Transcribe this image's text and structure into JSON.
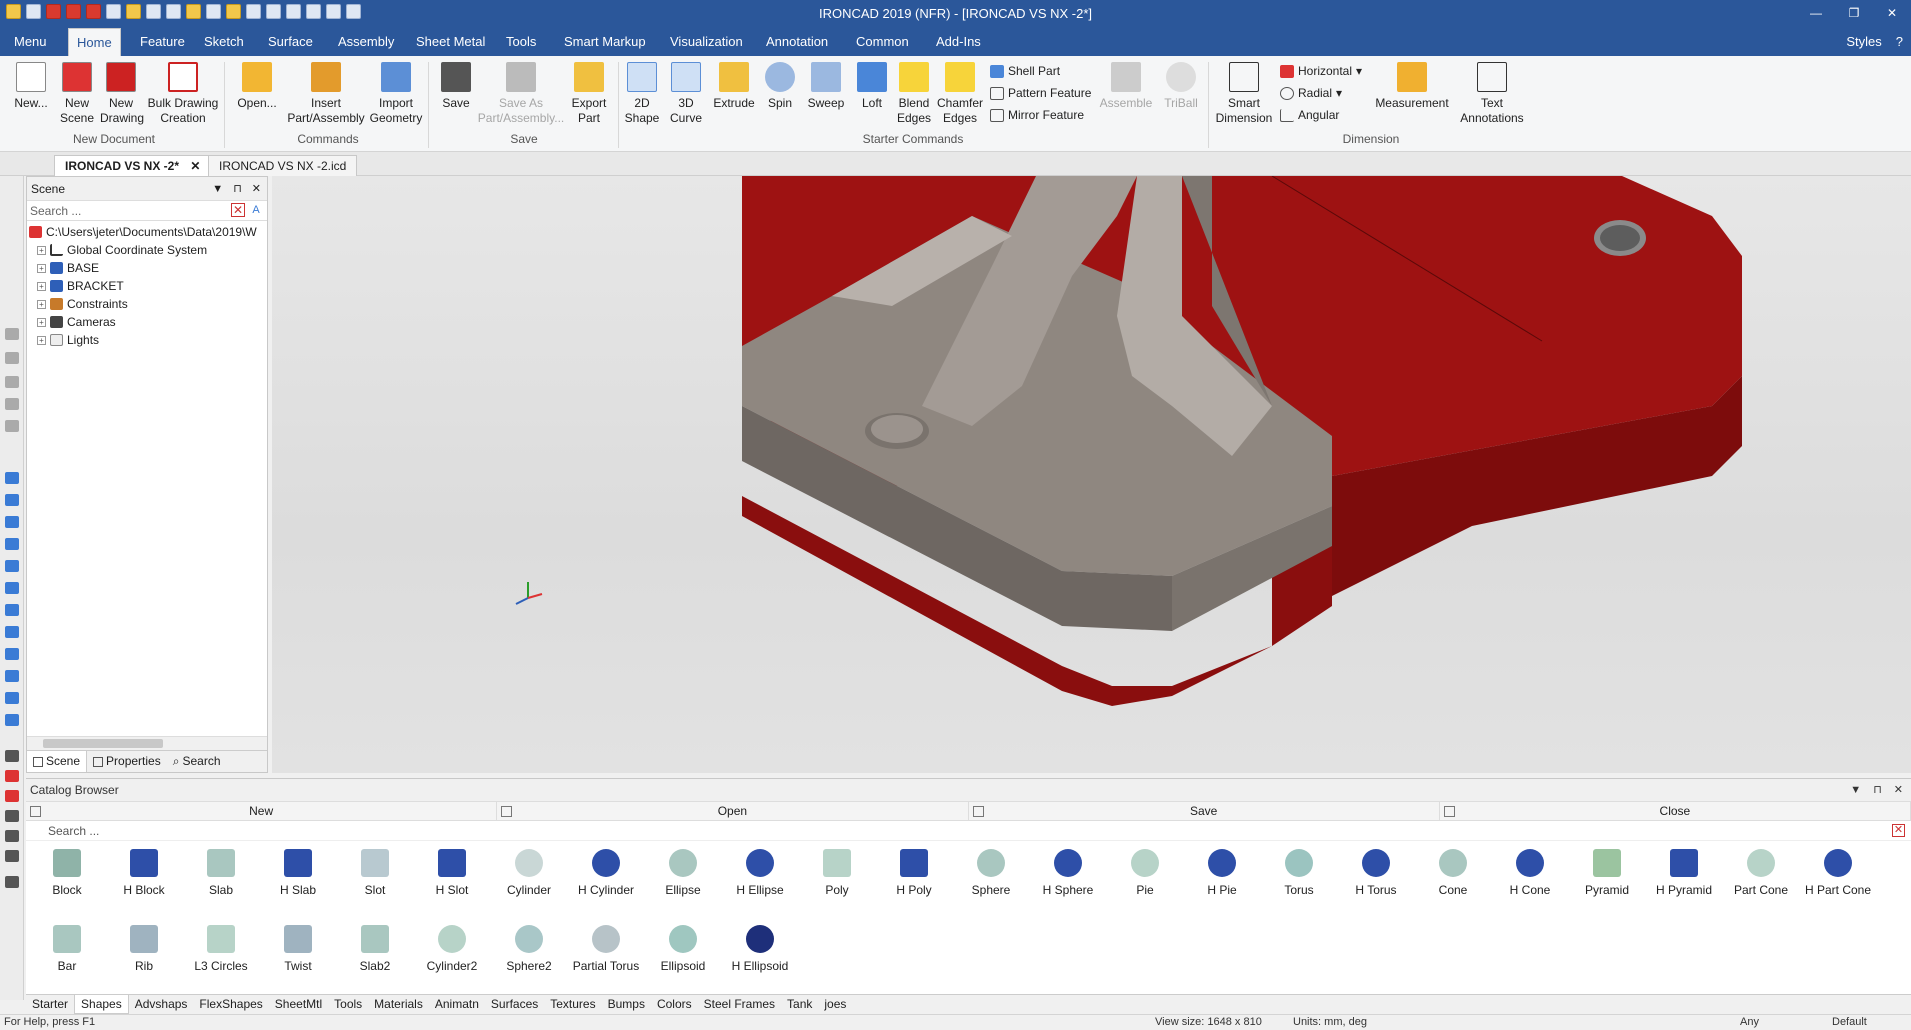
{
  "app": {
    "title": "IRONCAD 2019 (NFR) - [IRONCAD VS NX -2*]",
    "window_controls": [
      "—",
      "❐",
      "✕"
    ]
  },
  "ribbon_tabs": [
    "Menu",
    "Home",
    "Feature",
    "Sketch",
    "Surface",
    "Assembly",
    "Sheet Metal",
    "Tools",
    "Smart Markup",
    "Visualization",
    "Annotation",
    "Common",
    "Add-Ins"
  ],
  "ribbon_active": "Home",
  "ribbon_right": {
    "styles": "Styles",
    "help": "?"
  },
  "ribbon": {
    "new": "New...",
    "new_scene": "New\nScene",
    "new_drawing": "New\nDrawing",
    "bulk_drawing": "Bulk Drawing\nCreation",
    "group_new_document": "New Document",
    "open": "Open...",
    "insert_part": "Insert\nPart/Assembly",
    "import_geometry": "Import\nGeometry",
    "group_commands": "Commands",
    "save": "Save",
    "save_as": "Save As\nPart/Assembly...",
    "export_part": "Export\nPart",
    "group_save": "Save",
    "shape2d": "2D\nShape",
    "curve3d": "3D\nCurve",
    "extrude": "Extrude",
    "spin": "Spin",
    "sweep": "Sweep",
    "loft": "Loft",
    "blend_edges": "Blend\nEdges",
    "chamfer_edges": "Chamfer\nEdges",
    "shell_part": "Shell Part",
    "pattern_feature": "Pattern Feature",
    "mirror_feature": "Mirror Feature",
    "assemble": "Assemble",
    "triball": "TriBall",
    "group_starter": "Starter Commands",
    "smart_dimension": "Smart\nDimension",
    "horizontal": "Horizontal",
    "radial": "Radial",
    "angular": "Angular",
    "measurement": "Measurement",
    "text_annotations": "Text\nAnnotations",
    "group_dimension": "Dimension"
  },
  "doc_tabs": [
    {
      "label": "IRONCAD VS NX -2*",
      "active": true,
      "close": "✕"
    },
    {
      "label": "IRONCAD VS NX -2.icd",
      "active": false
    }
  ],
  "scene": {
    "title": "Scene",
    "search_placeholder": "Search ...",
    "tree": [
      {
        "label": "C:\\Users\\jeter\\Documents\\Data\\2019\\W",
        "icon": "ironcad-root-icon"
      },
      {
        "label": "Global Coordinate System",
        "icon": "axes-icon"
      },
      {
        "label": "BASE",
        "icon": "part-icon"
      },
      {
        "label": "BRACKET",
        "icon": "part-icon"
      },
      {
        "label": "Constraints",
        "icon": "constraint-icon"
      },
      {
        "label": "Cameras",
        "icon": "camera-icon"
      },
      {
        "label": "Lights",
        "icon": "light-icon"
      }
    ],
    "bottom_tabs": [
      "Scene",
      "Properties",
      "Search"
    ]
  },
  "catalog": {
    "title": "Catalog Browser",
    "actions": [
      "New",
      "Open",
      "Save",
      "Close"
    ],
    "search_placeholder": "Search ...",
    "items": [
      "Block",
      "H Block",
      "Slab",
      "H Slab",
      "Slot",
      "H Slot",
      "Cylinder",
      "H Cylinder",
      "Ellipse",
      "H Ellipse",
      "Poly",
      "H Poly",
      "Sphere",
      "H Sphere",
      "Pie",
      "H Pie",
      "Torus",
      "H Torus",
      "Cone",
      "H Cone",
      "Pyramid",
      "H Pyramid",
      "Part Cone",
      "H Part Cone",
      "Bar",
      "Rib",
      "L3 Circles",
      "Twist",
      "Slab2",
      "Cylinder2",
      "Sphere2",
      "Partial Torus",
      "Ellipsoid",
      "H Ellipsoid"
    ],
    "tabs": [
      "Starter",
      "Shapes",
      "Advshaps",
      "FlexShapes",
      "SheetMtl",
      "Tools",
      "Materials",
      "Animatn",
      "Surfaces",
      "Textures",
      "Bumps",
      "Colors",
      "Steel Frames",
      "Tank",
      "joes"
    ],
    "active_tab": "Shapes"
  },
  "status": {
    "help": "For Help, press F1",
    "view_size": "View size: 1648 x 810",
    "units": "Units: mm, deg",
    "filter": "Any",
    "preset": "Default"
  },
  "colors": {
    "accent": "#2b579a",
    "part_red": "#a31414",
    "part_gray": "#8f8780"
  }
}
